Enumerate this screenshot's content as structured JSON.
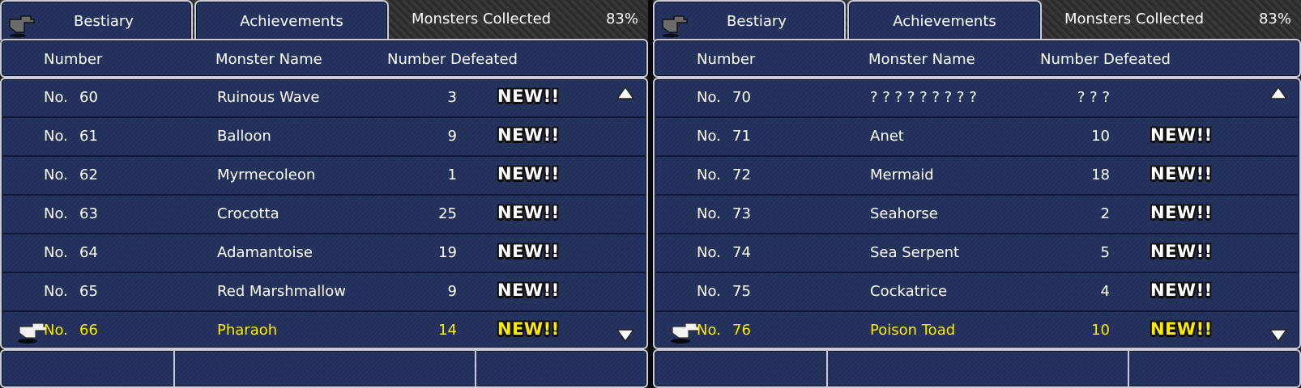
{
  "screens": [
    {
      "tabs": [
        "Bestiary",
        "Achievements"
      ],
      "collected_label": "Monsters Collected",
      "collected_pct": "83%",
      "headers": [
        "Number",
        "Monster Name",
        "Number Defeated"
      ],
      "rows": [
        {
          "no": "No.",
          "num": "60",
          "name": "Ruinous Wave",
          "defeated": "3",
          "new": "NEW!!"
        },
        {
          "no": "No.",
          "num": "61",
          "name": "Balloon",
          "defeated": "9",
          "new": "NEW!!"
        },
        {
          "no": "No.",
          "num": "62",
          "name": "Myrmecoleon",
          "defeated": "1",
          "new": "NEW!!"
        },
        {
          "no": "No.",
          "num": "63",
          "name": "Crocotta",
          "defeated": "25",
          "new": "NEW!!"
        },
        {
          "no": "No.",
          "num": "64",
          "name": "Adamantoise",
          "defeated": "19",
          "new": "NEW!!"
        },
        {
          "no": "No.",
          "num": "65",
          "name": "Red Marshmallow",
          "defeated": "9",
          "new": "NEW!!"
        },
        {
          "no": "No.",
          "num": "66",
          "name": "Pharaoh",
          "defeated": "14",
          "new": "NEW!!"
        }
      ]
    },
    {
      "tabs": [
        "Bestiary",
        "Achievements"
      ],
      "collected_label": "Monsters Collected",
      "collected_pct": "83%",
      "headers": [
        "Number",
        "Monster Name",
        "Number Defeated"
      ],
      "rows": [
        {
          "no": "No.",
          "num": "70",
          "name": "? ? ? ? ? ? ? ? ?",
          "defeated": "? ? ?",
          "new": ""
        },
        {
          "no": "No.",
          "num": "71",
          "name": "Anet",
          "defeated": "10",
          "new": "NEW!!"
        },
        {
          "no": "No.",
          "num": "72",
          "name": "Mermaid",
          "defeated": "18",
          "new": "NEW!!"
        },
        {
          "no": "No.",
          "num": "73",
          "name": "Seahorse",
          "defeated": "2",
          "new": "NEW!!"
        },
        {
          "no": "No.",
          "num": "74",
          "name": "Sea Serpent",
          "defeated": "5",
          "new": "NEW!!"
        },
        {
          "no": "No.",
          "num": "75",
          "name": "Cockatrice",
          "defeated": "4",
          "new": "NEW!!"
        },
        {
          "no": "No.",
          "num": "76",
          "name": "Poison Toad",
          "defeated": "10",
          "new": "NEW!!"
        }
      ]
    }
  ],
  "colors": {
    "panel": "#25345d",
    "border": "#c9ccd6",
    "selected_text": "#ffeb00"
  },
  "icons": {
    "tab_cursor": "pointing-hand-icon",
    "row_cursor": "pointing-hand-icon",
    "scroll_up": "triangle-up-icon",
    "scroll_down": "triangle-down-icon"
  }
}
